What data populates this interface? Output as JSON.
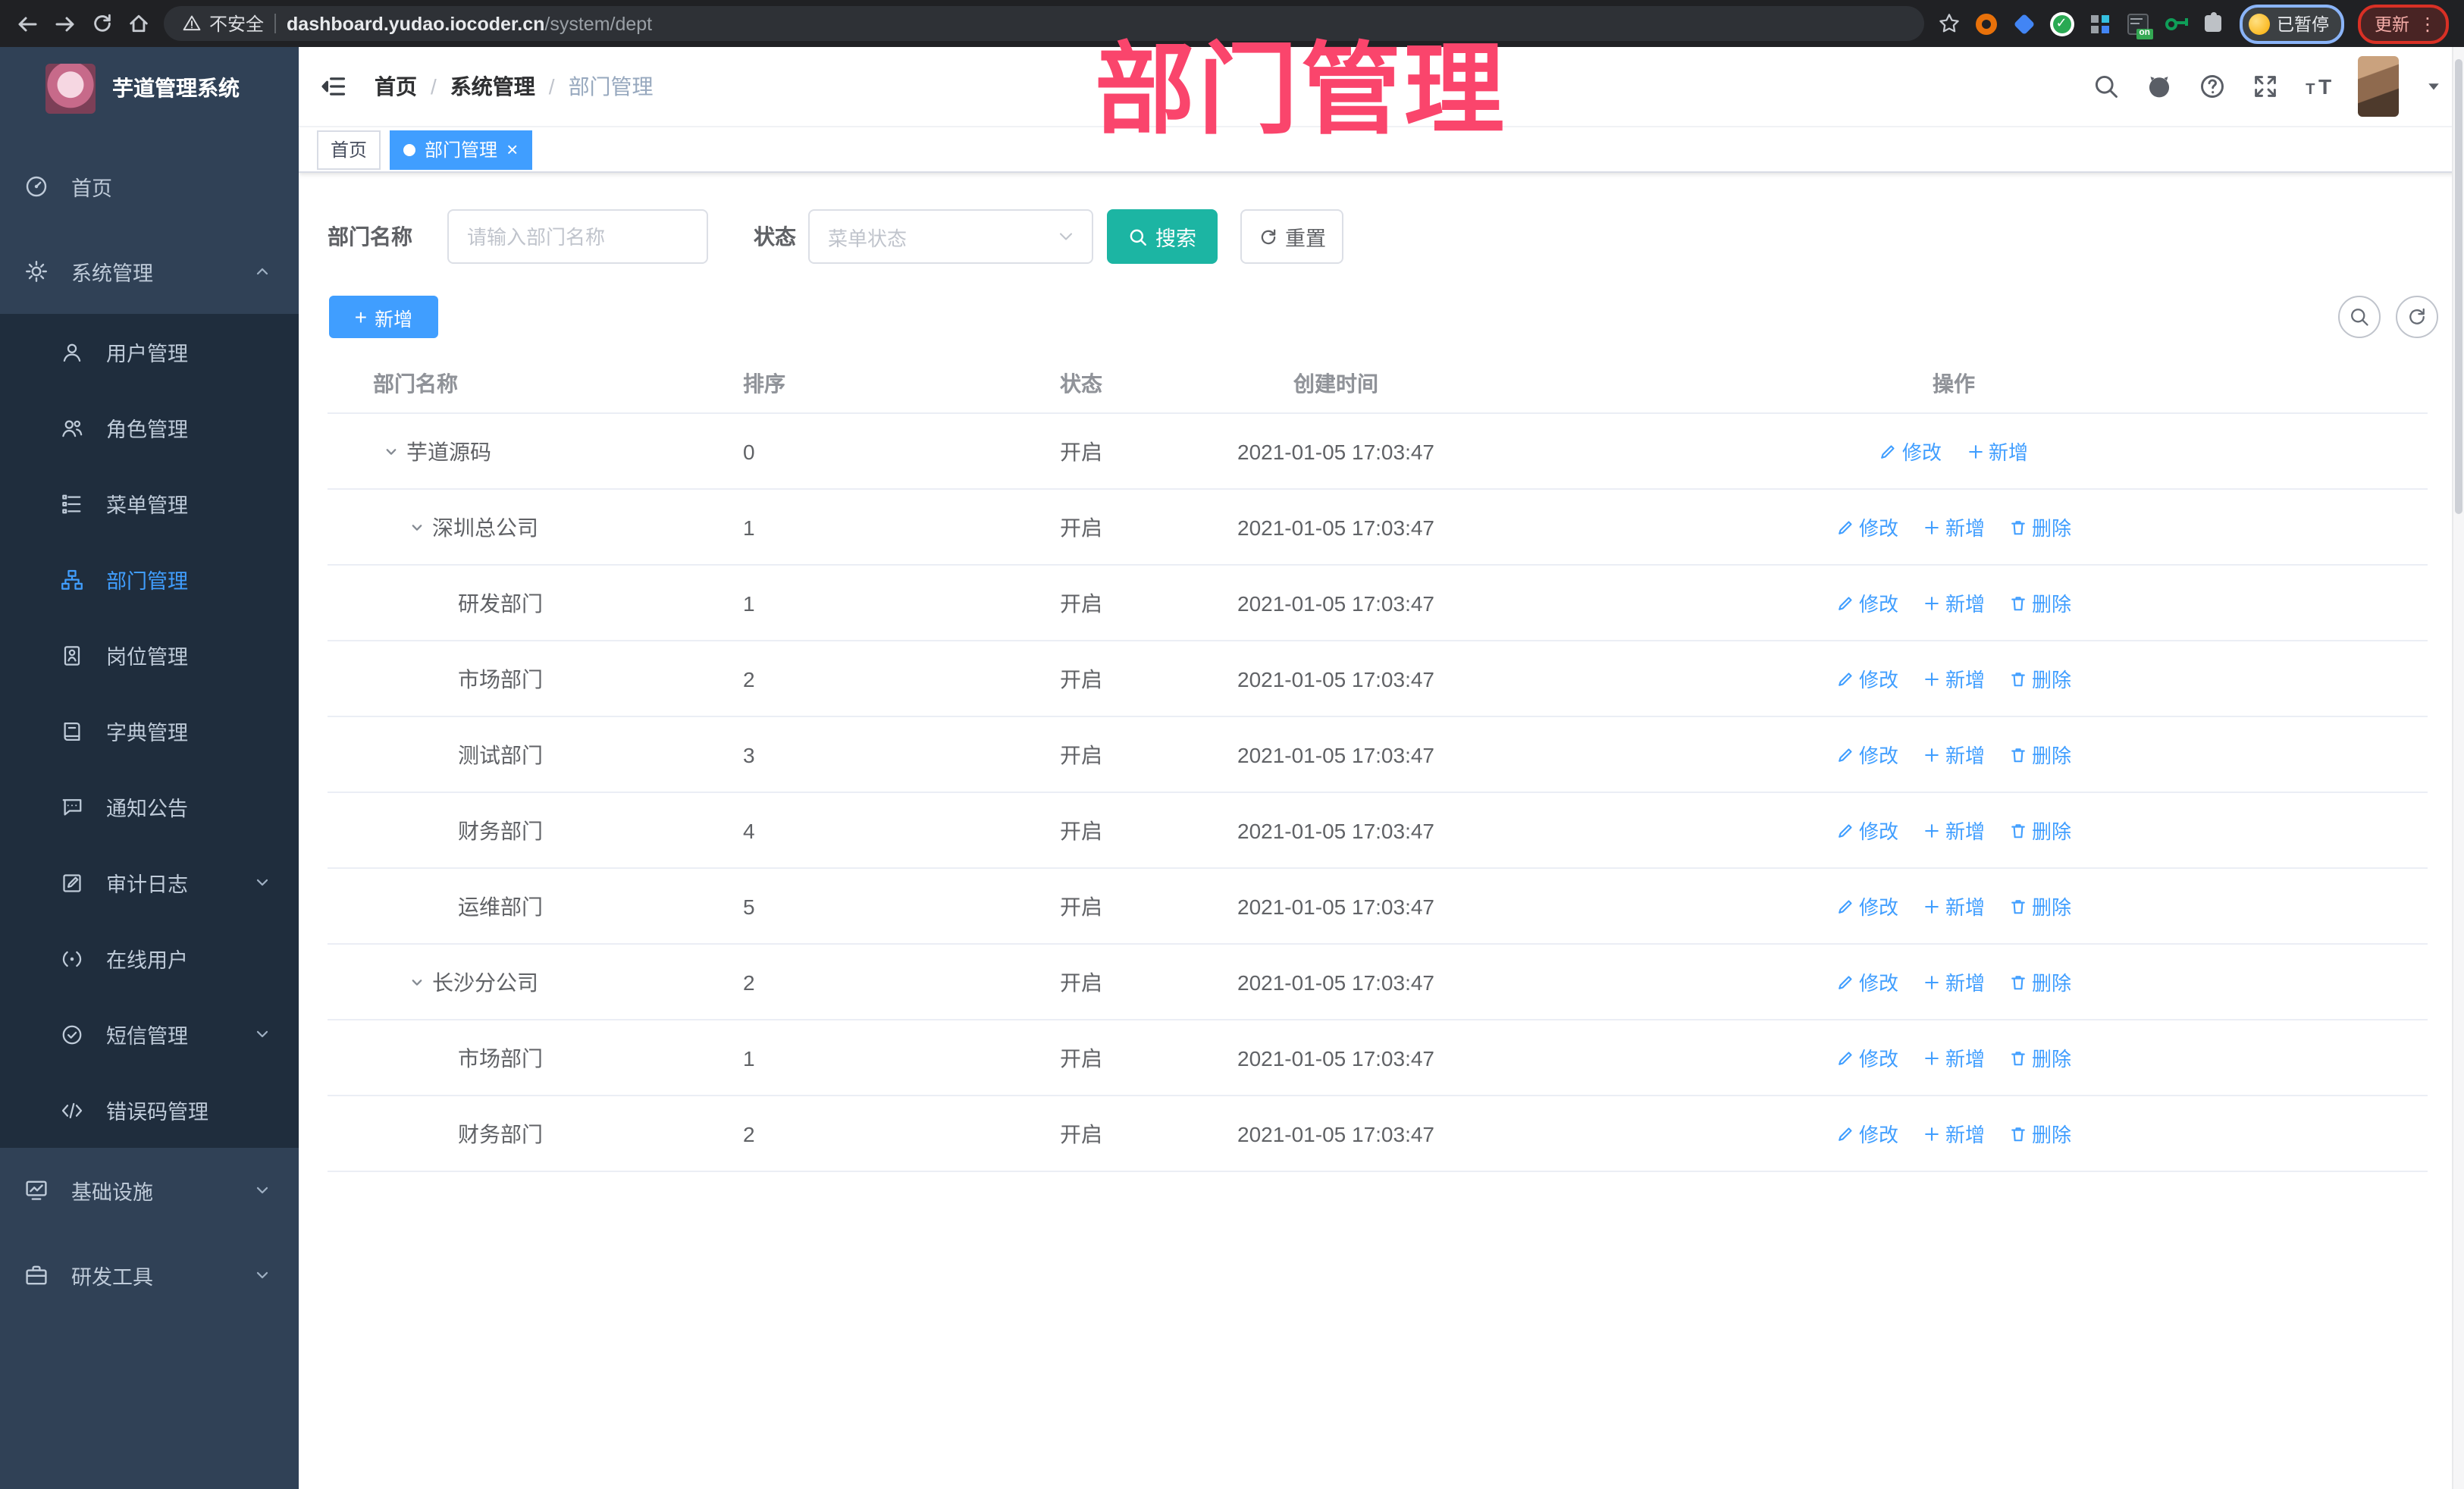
{
  "browser": {
    "security_label": "不安全",
    "url_host": "dashboard.yudao.iocoder.cn",
    "url_path": "/system/dept",
    "profile_chip_label": "已暂停",
    "update_button_label": "更新",
    "extensions": [
      {
        "name": "ext-orange-donut",
        "shape": "donut",
        "color": "#e8710a"
      },
      {
        "name": "ext-blue-gem",
        "shape": "diamond",
        "color": "#4285f4"
      },
      {
        "name": "ext-green-check",
        "shape": "circle-check",
        "color": "#2aa953"
      },
      {
        "name": "ext-blue-grid",
        "shape": "grid",
        "color": "#669df6"
      },
      {
        "name": "ext-on-badge",
        "shape": "on-badge",
        "color": "#34a853"
      },
      {
        "name": "ext-green-key",
        "shape": "key",
        "color": "#0f9d58"
      },
      {
        "name": "ext-puzzle",
        "shape": "puzzle",
        "color": "#bdc1c6"
      }
    ]
  },
  "watermark": {
    "text": "部门管理",
    "color": "#fa456c"
  },
  "sidebar": {
    "logo_title": "芋道管理系统",
    "primary": [
      {
        "label": "首页",
        "icon": "dashboard-icon"
      },
      {
        "label": "系统管理",
        "icon": "gear-icon",
        "chevron": "up"
      }
    ],
    "submenu": [
      {
        "label": "用户管理",
        "icon": "user-icon"
      },
      {
        "label": "角色管理",
        "icon": "roles-icon"
      },
      {
        "label": "菜单管理",
        "icon": "menu-tree-icon"
      },
      {
        "label": "部门管理",
        "icon": "org-tree-icon",
        "active": true
      },
      {
        "label": "岗位管理",
        "icon": "post-badge-icon"
      },
      {
        "label": "字典管理",
        "icon": "dict-book-icon"
      },
      {
        "label": "通知公告",
        "icon": "announcement-icon"
      },
      {
        "label": "审计日志",
        "icon": "audit-log-icon",
        "chevron": "down"
      },
      {
        "label": "在线用户",
        "icon": "online-user-icon"
      },
      {
        "label": "短信管理",
        "icon": "sms-clock-icon",
        "chevron": "down"
      },
      {
        "label": "错误码管理",
        "icon": "error-code-icon"
      }
    ],
    "secondary": [
      {
        "label": "基础设施",
        "icon": "infra-monitor-icon",
        "chevron": "down"
      },
      {
        "label": "研发工具",
        "icon": "dev-tools-icon",
        "chevron": "down"
      }
    ]
  },
  "header": {
    "breadcrumb": [
      "首页",
      "系统管理",
      "部门管理"
    ],
    "icons": [
      "search-icon",
      "github-icon",
      "help-icon",
      "fullscreen-icon",
      "font-size-icon"
    ]
  },
  "tags": [
    {
      "label": "首页",
      "active": false
    },
    {
      "label": "部门管理",
      "active": true
    }
  ],
  "search_form": {
    "dept_name_label": "部门名称",
    "dept_name_placeholder": "请输入部门名称",
    "status_label": "状态",
    "status_placeholder": "菜单状态",
    "search_button": "搜索",
    "reset_button": "重置"
  },
  "toolbar": {
    "add_button": "新增"
  },
  "table": {
    "columns": [
      "部门名称",
      "排序",
      "状态",
      "创建时间",
      "操作"
    ],
    "action_labels": {
      "edit": "修改",
      "add": "新增",
      "delete": "删除"
    },
    "rows": [
      {
        "name": "芋道源码",
        "indent": 0,
        "expandable": true,
        "sort": "0",
        "status": "开启",
        "created": "2021-01-05 17:03:47",
        "actions": [
          "edit",
          "add"
        ]
      },
      {
        "name": "深圳总公司",
        "indent": 1,
        "expandable": true,
        "sort": "1",
        "status": "开启",
        "created": "2021-01-05 17:03:47",
        "actions": [
          "edit",
          "add",
          "delete"
        ]
      },
      {
        "name": "研发部门",
        "indent": 2,
        "expandable": false,
        "sort": "1",
        "status": "开启",
        "created": "2021-01-05 17:03:47",
        "actions": [
          "edit",
          "add",
          "delete"
        ]
      },
      {
        "name": "市场部门",
        "indent": 2,
        "expandable": false,
        "sort": "2",
        "status": "开启",
        "created": "2021-01-05 17:03:47",
        "actions": [
          "edit",
          "add",
          "delete"
        ]
      },
      {
        "name": "测试部门",
        "indent": 2,
        "expandable": false,
        "sort": "3",
        "status": "开启",
        "created": "2021-01-05 17:03:47",
        "actions": [
          "edit",
          "add",
          "delete"
        ]
      },
      {
        "name": "财务部门",
        "indent": 2,
        "expandable": false,
        "sort": "4",
        "status": "开启",
        "created": "2021-01-05 17:03:47",
        "actions": [
          "edit",
          "add",
          "delete"
        ]
      },
      {
        "name": "运维部门",
        "indent": 2,
        "expandable": false,
        "sort": "5",
        "status": "开启",
        "created": "2021-01-05 17:03:47",
        "actions": [
          "edit",
          "add",
          "delete"
        ]
      },
      {
        "name": "长沙分公司",
        "indent": 1,
        "expandable": true,
        "sort": "2",
        "status": "开启",
        "created": "2021-01-05 17:03:47",
        "actions": [
          "edit",
          "add",
          "delete"
        ]
      },
      {
        "name": "市场部门",
        "indent": 2,
        "expandable": false,
        "sort": "1",
        "status": "开启",
        "created": "2021-01-05 17:03:47",
        "actions": [
          "edit",
          "add",
          "delete"
        ]
      },
      {
        "name": "财务部门",
        "indent": 2,
        "expandable": false,
        "sort": "2",
        "status": "开启",
        "created": "2021-01-05 17:03:47",
        "actions": [
          "edit",
          "add",
          "delete"
        ]
      }
    ]
  },
  "colors": {
    "primary": "#409eff",
    "teal": "#1cb5a3",
    "sidebar_bg": "#304156",
    "submenu_bg": "#1f2d3d",
    "watermark": "#fa456c"
  }
}
